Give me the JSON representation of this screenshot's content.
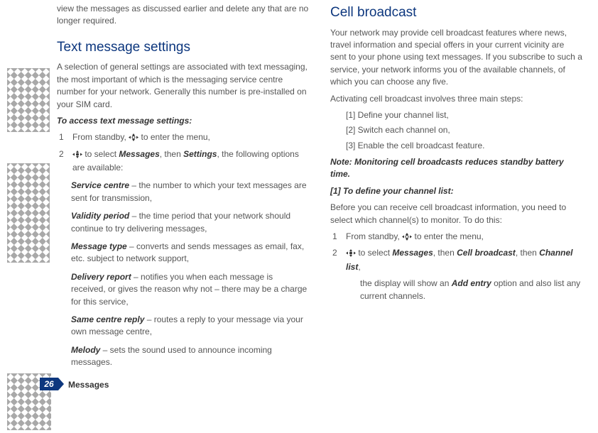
{
  "col1": {
    "intro_top": "view the messages as discussed earlier and delete any that are no longer required.",
    "heading": "Text message settings",
    "intro": "A selection of general settings are associated with text messaging, the most important of which is the messaging service centre number for your network. Generally this number is pre-installed on your SIM card.",
    "access_heading": "To access text message settings:",
    "step1_a": "From standby, ",
    "step1_b": " to enter the menu,",
    "step2_a": " to select ",
    "step2_b": "Messages",
    "step2_c": ", then ",
    "step2_d": "Settings",
    "step2_e": ", the following options are available:",
    "options": [
      {
        "term": "Service centre",
        "desc": " – the number to which your text messages are sent for transmission,"
      },
      {
        "term": "Validity period",
        "desc": " – the time period that your network should continue to try delivering messages,"
      },
      {
        "term": "Message type",
        "desc": " – converts and sends messages as email, fax, etc. subject to network support,"
      },
      {
        "term": "Delivery report",
        "desc": " – notifies you when each message is received, or gives the reason why not – there may be a charge for this service,"
      },
      {
        "term": "Same centre reply",
        "desc": " – routes a reply to your message via your own message centre,"
      },
      {
        "term": "Melody",
        "desc": " – sets the sound used to announce incoming messages."
      }
    ]
  },
  "col2": {
    "heading": "Cell broadcast",
    "intro": "Your network may provide cell broadcast features where news, travel information and special offers in your current vicinity are sent to your phone using text messages. If you subscribe to such a service, your network informs you of the available channels, of which you can choose any five.",
    "activating": "Activating cell broadcast involves three main steps:",
    "steps3": [
      "[1] Define your channel list,",
      "[2] Switch each channel on,",
      "[3] Enable the cell broadcast feature."
    ],
    "note": "Note: Monitoring cell broadcasts reduces standby battery time.",
    "sub_heading": "[1] To define your channel list:",
    "sub_intro": "Before you can receive cell broadcast information, you need to select which channel(s) to monitor. To do this:",
    "s1_a": "From standby, ",
    "s1_b": " to enter the menu,",
    "s2_a": " to select ",
    "s2_b": "Messages",
    "s2_c": ", then ",
    "s2_d": "Cell broadcast",
    "s2_e": ", then ",
    "s2_f": "Channel list",
    "s2_g": ",",
    "result_a": "the display will show an ",
    "result_b": "Add entry",
    "result_c": " option and also list any current channels."
  },
  "footer": {
    "page_number": "26",
    "section": "Messages"
  },
  "icons": {
    "nav4": "nav-4-way-icon",
    "nav_center": "nav-center-press-icon"
  }
}
